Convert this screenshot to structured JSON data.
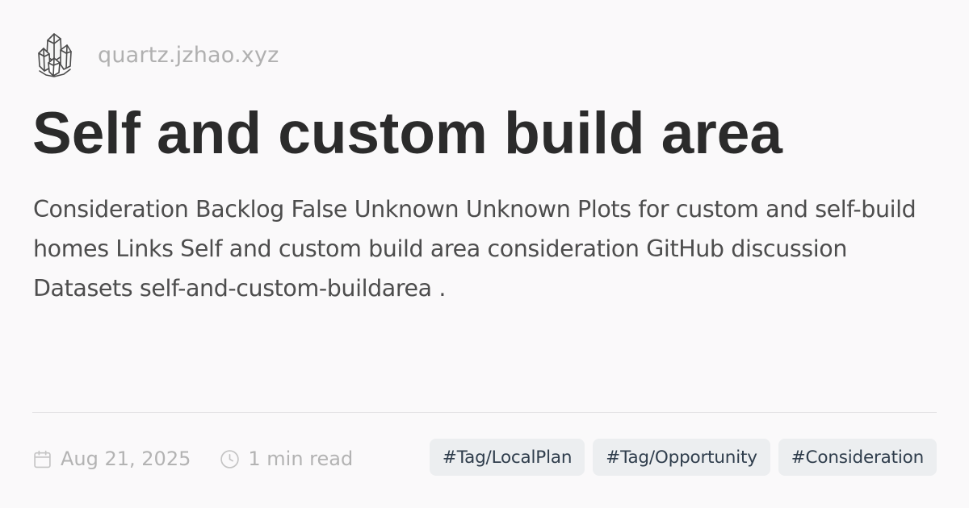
{
  "site": {
    "logo_icon": "crystal-cluster-icon",
    "name": "quartz.jzhao.xyz"
  },
  "page": {
    "title": "Self and custom build area",
    "description": "Consideration Backlog False Unknown Unknown Plots for custom and self-build homes Links Self and custom build area consideration GitHub discussion Datasets self-and-custom-buildarea ."
  },
  "meta": {
    "date_icon": "calendar-icon",
    "date": "Aug 21, 2025",
    "reading_time_icon": "clock-icon",
    "reading_time": "1 min read"
  },
  "tags": [
    "#Tag/LocalPlan",
    "#Tag/Opportunity",
    "#Consideration"
  ],
  "colors": {
    "background": "#faf9fa",
    "title": "#2b2b2b",
    "description": "#4d4d4d",
    "muted": "#b0b0b0",
    "tag_background": "#eceef0",
    "tag_text": "#2f3d4c"
  }
}
